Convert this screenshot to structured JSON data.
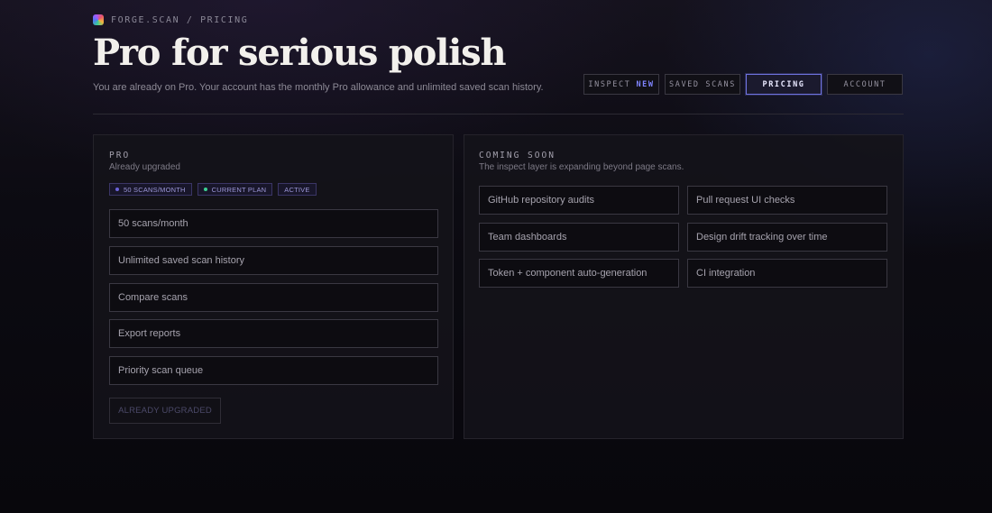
{
  "breadcrumb": "FORGE.SCAN / PRICING",
  "title": "Pro for serious polish",
  "subtitle": "You are already on Pro. Your account has the monthly Pro allowance and unlimited saved scan history.",
  "nav": [
    {
      "label": "INSPECT",
      "badge": "NEW",
      "active": false
    },
    {
      "label": "SAVED SCANS",
      "active": false
    },
    {
      "label": "PRICING",
      "active": true
    },
    {
      "label": "ACCOUNT",
      "active": false
    }
  ],
  "pro_panel": {
    "eyebrow": "PRO",
    "status": "Already upgraded",
    "badges": [
      {
        "label": "50 SCANS/MONTH",
        "dot_color": "#6b63d9"
      },
      {
        "label": "CURRENT PLAN",
        "dot_color": "#3ccf91"
      },
      {
        "label": "ACTIVE"
      }
    ],
    "features": [
      "50 scans/month",
      "Unlimited saved scan history",
      "Compare scans",
      "Export reports",
      "Priority scan queue"
    ],
    "button_label": "ALREADY UPGRADED",
    "button_disabled": true
  },
  "coming_soon": {
    "eyebrow": "COMING SOON",
    "description": "The inspect layer is expanding beyond page scans.",
    "items": [
      "GitHub repository audits",
      "Pull request UI checks",
      "Team dashboards",
      "Design drift tracking over time",
      "Token + component auto-generation",
      "CI integration"
    ]
  },
  "colors": {
    "accent": "#6f73e0",
    "background": "#0c0b12",
    "title": "#f2f0ec"
  }
}
